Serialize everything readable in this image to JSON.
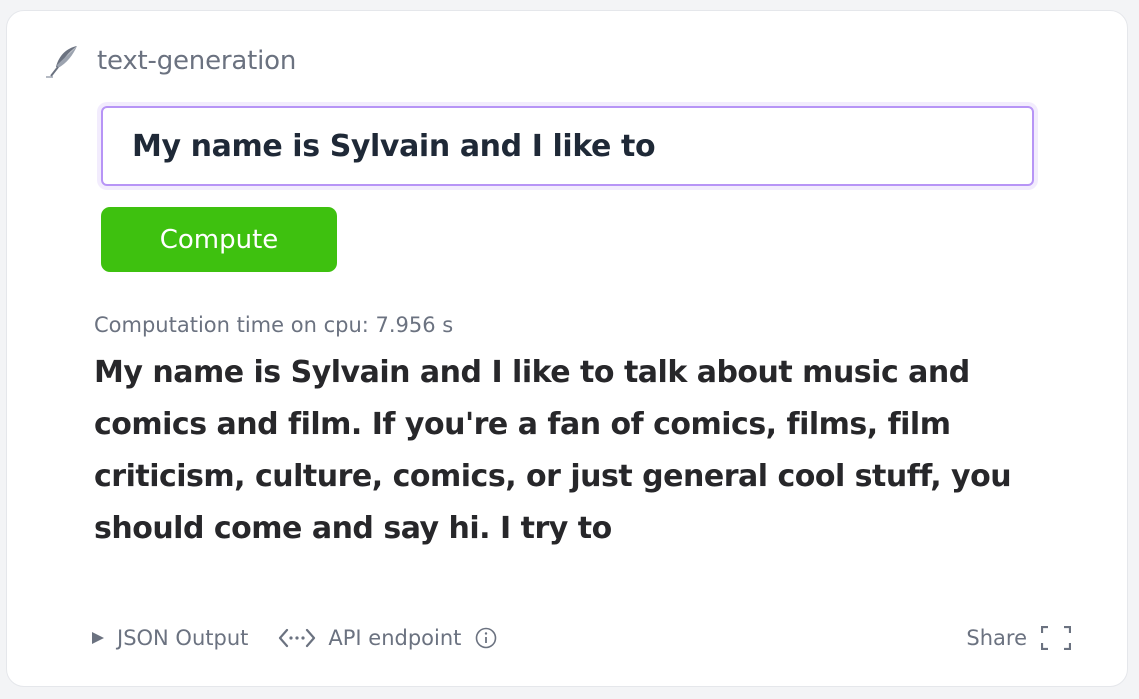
{
  "widget": {
    "task_label": "text-generation",
    "input": {
      "value": "My name is Sylvain and I like to"
    },
    "compute_label": "Compute",
    "timing_text": "Computation time on cpu: 7.956 s",
    "output_text": "My name is Sylvain and I like to talk about music and comics and film. If you're a fan of comics, films, film criticism, culture, comics, or just general cool stuff, you should come and say hi. I try to"
  },
  "footer": {
    "json_output_label": "JSON Output",
    "api_endpoint_label": "API endpoint",
    "share_label": "Share"
  },
  "colors": {
    "compute_bg": "#3ec10f",
    "input_border": "#b794f6"
  },
  "icons": [
    "quill-icon",
    "play-triangle-icon",
    "api-code-icon",
    "info-icon",
    "expand-icon"
  ]
}
